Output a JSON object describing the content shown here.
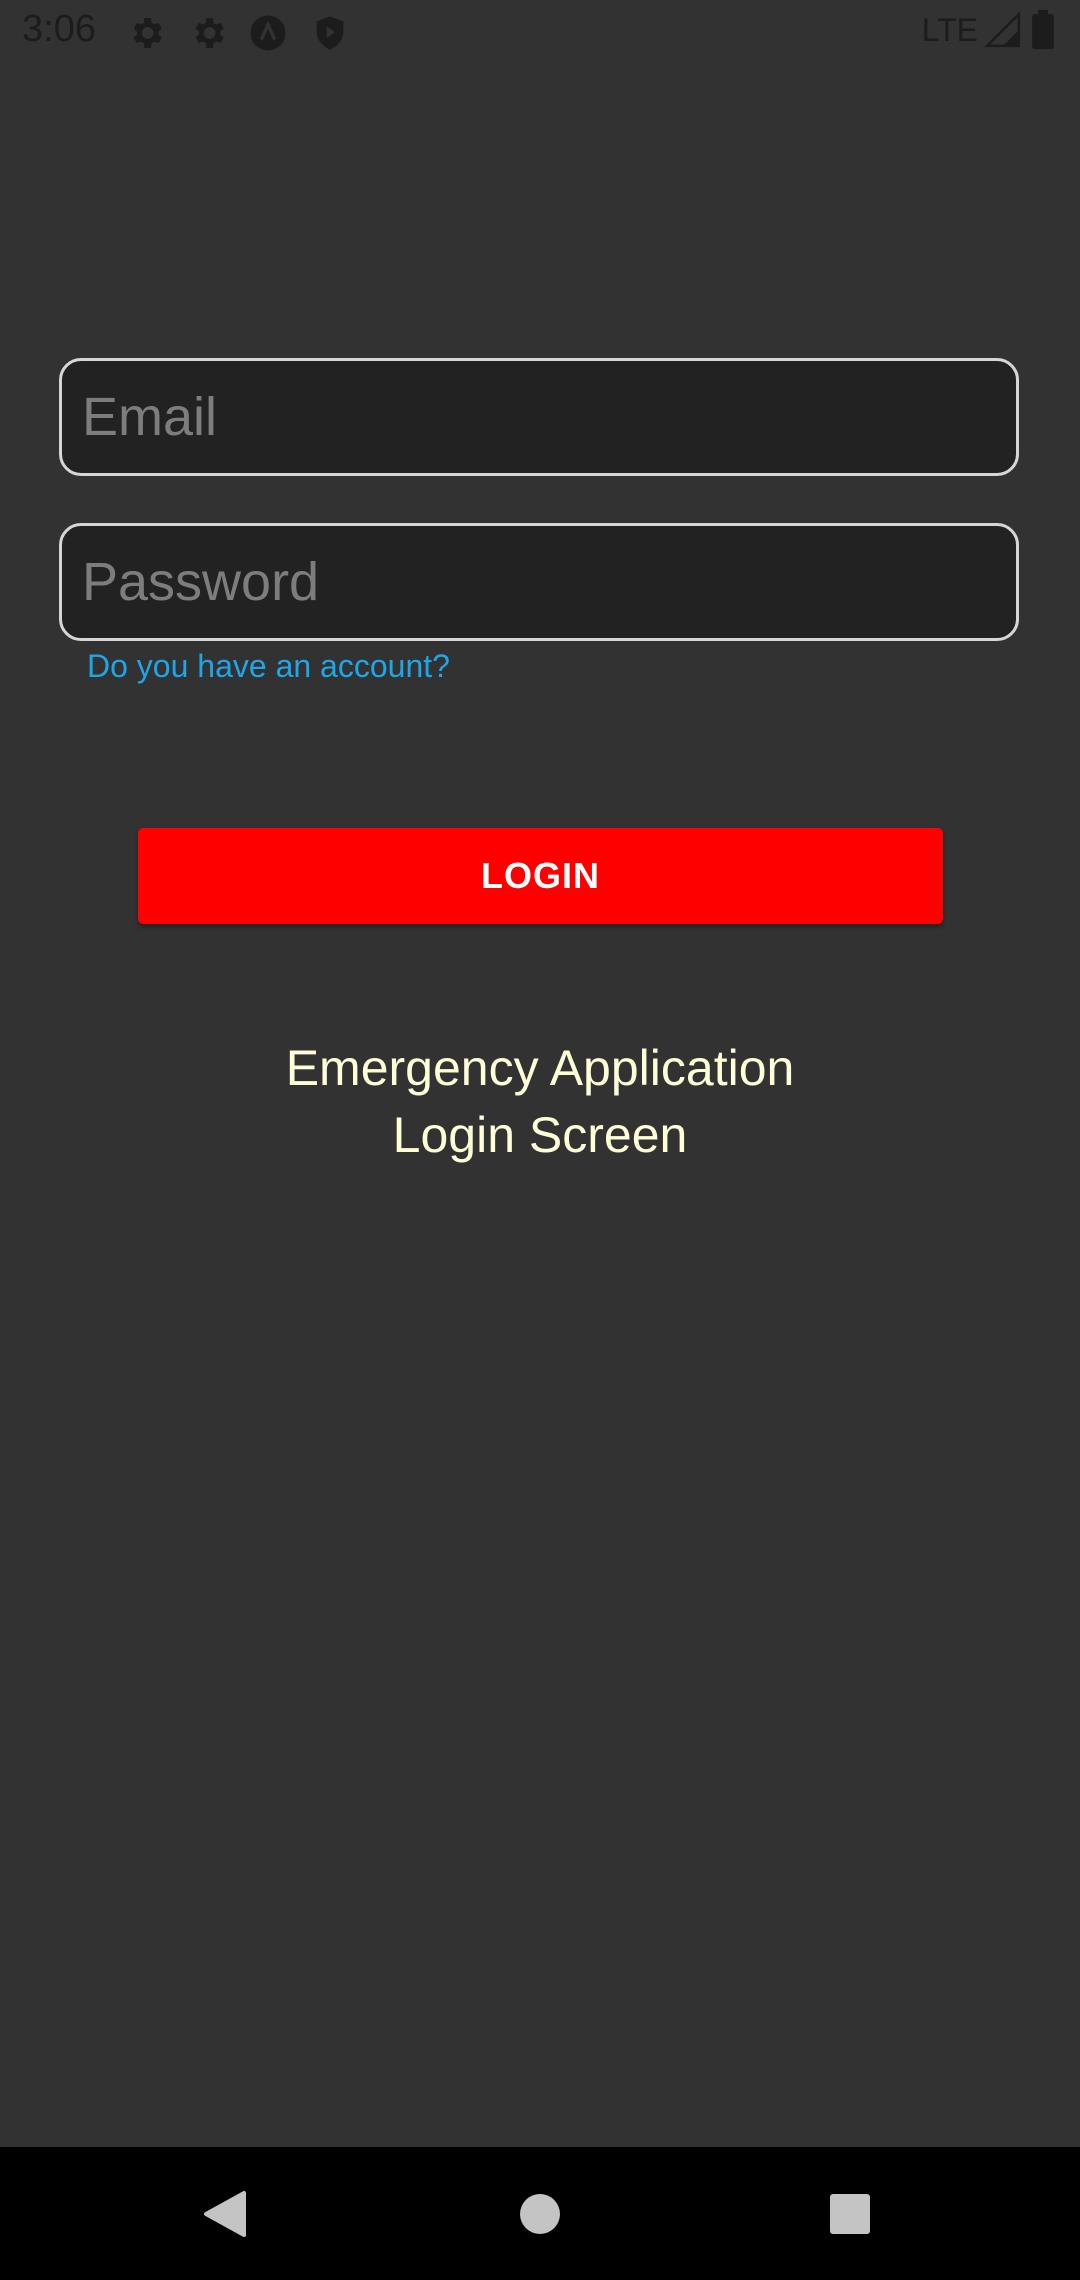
{
  "status_bar": {
    "time": "3:06",
    "icons": [
      "settings-icon",
      "settings-icon",
      "app-icon",
      "shield-play-icon"
    ],
    "network": "LTE",
    "right_icons": [
      "signal-icon",
      "battery-icon"
    ]
  },
  "form": {
    "email_placeholder": "Email",
    "email_value": "",
    "password_placeholder": "Password",
    "password_value": "",
    "account_link": "Do you have an account?",
    "login_label": "LOGIN"
  },
  "title": {
    "line1": "Emergency Application",
    "line2": "Login Screen"
  },
  "nav_bar": {
    "buttons": [
      "back-icon",
      "home-icon",
      "recents-icon"
    ]
  },
  "colors": {
    "background": "#323232",
    "input_background": "#222222",
    "input_border": "#d6d6d6",
    "link": "#1fa6e8",
    "button": "#ff0000",
    "title_text": "#fefed7",
    "nav_bar": "#000000"
  }
}
